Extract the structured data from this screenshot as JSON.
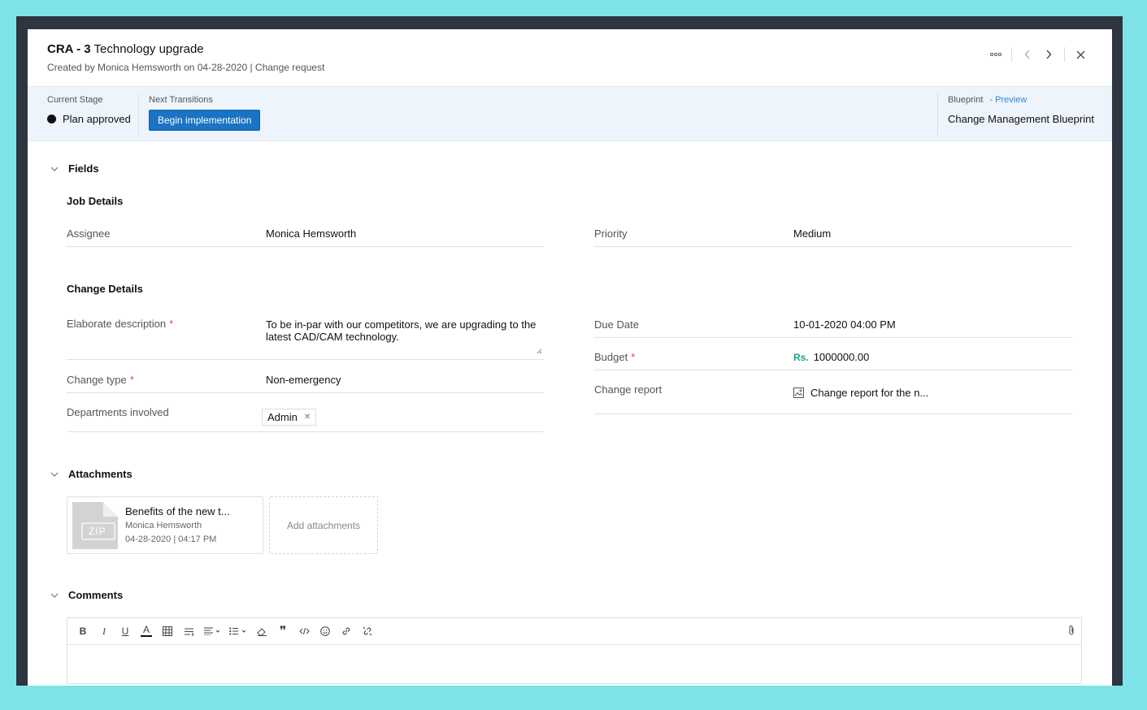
{
  "header": {
    "id": "CRA - 3",
    "title": "Technology upgrade",
    "subtitle": "Created by  Monica Hemsworth  on 04-28-2020 | Change request"
  },
  "icons": {
    "more": "more-horizontal-icon",
    "prev": "chevron-left-icon",
    "next": "chevron-right-icon",
    "close": "close-icon"
  },
  "stage": {
    "current_label": "Current Stage",
    "current_value": "Plan approved",
    "transitions_label": "Next Transitions",
    "transition_button": "Begin implementation",
    "blueprint_label": "Blueprint",
    "blueprint_preview": "- Preview",
    "blueprint_value": "Change Management Blueprint"
  },
  "fields_section": {
    "title": "Fields",
    "job_details": {
      "title": "Job Details",
      "assignee_label": "Assignee",
      "assignee_value": "Monica Hemsworth",
      "priority_label": "Priority",
      "priority_value": "Medium"
    },
    "change_details": {
      "title": "Change Details",
      "description_label": "Elaborate description",
      "description_value": "To be in-par with our competitors, we are upgrading to the latest CAD/CAM technology.",
      "change_type_label": "Change type",
      "change_type_value": "Non-emergency",
      "departments_label": "Departments involved",
      "departments_tag": "Admin",
      "due_date_label": "Due Date",
      "due_date_value": "10-01-2020 04:00 PM",
      "budget_label": "Budget",
      "budget_currency": "Rs.",
      "budget_value": "1000000.00",
      "report_label": "Change report",
      "report_value": "Change report for the n..."
    },
    "required_mark": "*"
  },
  "attachments": {
    "title": "Attachments",
    "file": {
      "name": "Benefits of the new t...",
      "type_badge": "ZIP",
      "owner": "Monica Hemsworth",
      "date": "04-28-2020 | 04:17 PM"
    },
    "add_label": "Add attachments"
  },
  "comments": {
    "title": "Comments",
    "toolbar": [
      "B",
      "I",
      "U",
      "A"
    ]
  },
  "colors": {
    "primary_button": "#1a73c4",
    "stage_bar": "#eef4fb",
    "required": "#e04848",
    "currency": "#1aa38a",
    "link": "#2d8ad6"
  }
}
